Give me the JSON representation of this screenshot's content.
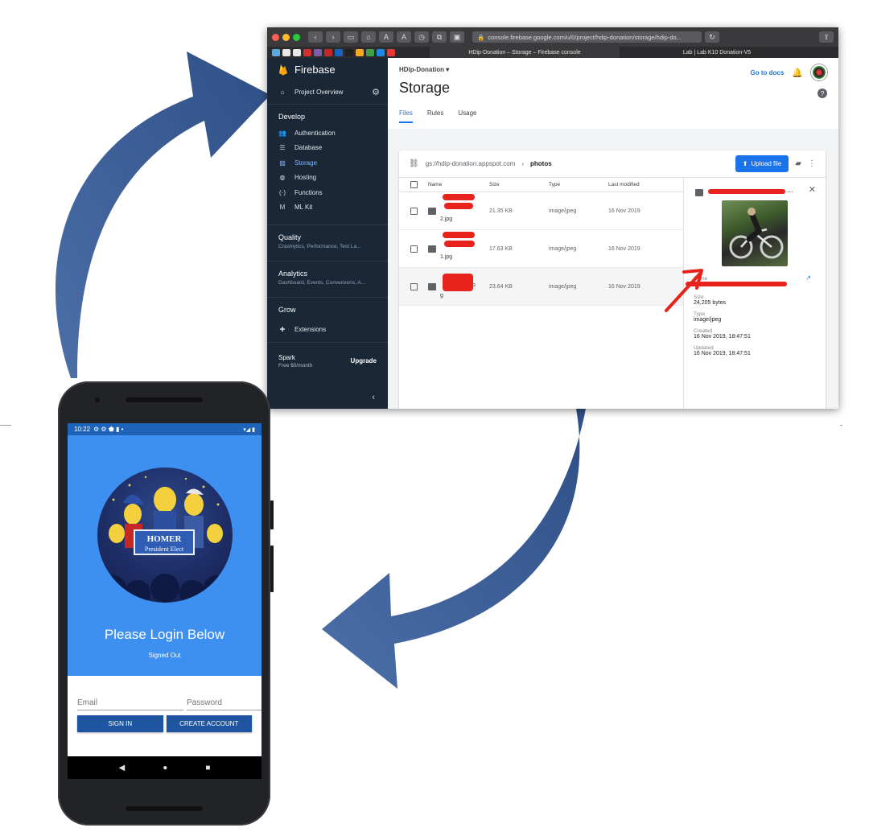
{
  "browser": {
    "url": "console.firebase.google.com/u/0/project/hdip-donation/storage/hdip-do...",
    "tabs": [
      {
        "label": "HDip-Donation – Storage – Firebase console",
        "active": true
      },
      {
        "label": "Lab | Lab K10 Donation-V5",
        "active": false
      }
    ],
    "text_size_buttons": [
      "A",
      "A"
    ]
  },
  "firebase": {
    "brand": "Firebase",
    "project_overview": "Project Overview",
    "sections": {
      "develop": {
        "title": "Develop",
        "items": [
          {
            "label": "Authentication",
            "icon": "people-icon"
          },
          {
            "label": "Database",
            "icon": "database-icon"
          },
          {
            "label": "Storage",
            "icon": "storage-icon",
            "active": true
          },
          {
            "label": "Hosting",
            "icon": "globe-icon"
          },
          {
            "label": "Functions",
            "icon": "functions-icon"
          },
          {
            "label": "ML Kit",
            "icon": "mlkit-icon"
          }
        ]
      },
      "quality": {
        "title": "Quality",
        "subtitle": "Crashlytics, Performance, Test La..."
      },
      "analytics": {
        "title": "Analytics",
        "subtitle": "Dashboard, Events, Conversions, A..."
      },
      "grow": {
        "title": "Grow",
        "items": [
          {
            "label": "Extensions",
            "icon": "extensions-icon"
          }
        ]
      }
    },
    "plan": {
      "name": "Spark",
      "price": "Free $0/month",
      "upgrade": "Upgrade"
    },
    "header": {
      "project": "HDip-Donation",
      "go_to_docs": "Go to docs",
      "page_title": "Storage"
    },
    "tabs": [
      "Files",
      "Rules",
      "Usage"
    ],
    "bucket": {
      "path": "gs://hdip-donation.appspot.com",
      "folder": "photos",
      "upload": "Upload file"
    },
    "columns": [
      "Name",
      "Size",
      "Type",
      "Last modified"
    ],
    "files": [
      {
        "name": "2.jpg",
        "size": "21.35 KB",
        "type": "image/jpeg",
        "modified": "16 Nov 2019"
      },
      {
        "name": "1.jpg",
        "size": "17.63 KB",
        "type": "image/jpeg",
        "modified": "16 Nov 2019"
      },
      {
        "name_tail": "p",
        "name_line2": "g",
        "size": "23.64 KB",
        "type": "image/jpeg",
        "modified": "16 Nov 2019"
      }
    ],
    "detail": {
      "name_label": "Name",
      "size_label": "Size",
      "size_value": "24,205 bytes",
      "type_label": "Type",
      "type_value": "image/jpeg",
      "created_label": "Created",
      "created_value": "16 Nov 2019, 18:47:51",
      "updated_label": "Updated",
      "updated_value": "16 Nov 2019, 18:47:51",
      "ellipsis": "..."
    }
  },
  "phone": {
    "status_time": "10:22",
    "poster_title": "HOMER",
    "poster_subtitle": "President Elect",
    "login_title": "Please Login Below",
    "login_status": "Signed Out",
    "email_placeholder": "Email",
    "password_placeholder": "Password",
    "sign_in": "SIGN IN",
    "create_account": "CREATE ACCOUNT"
  },
  "colors": {
    "arrow": "#3a5a8e",
    "firebase_sidebar": "#192737",
    "accent_blue": "#1a73e8",
    "phone_hero": "#3d8ff0",
    "app_button": "#1f55a0",
    "redaction": "#e8231c"
  }
}
